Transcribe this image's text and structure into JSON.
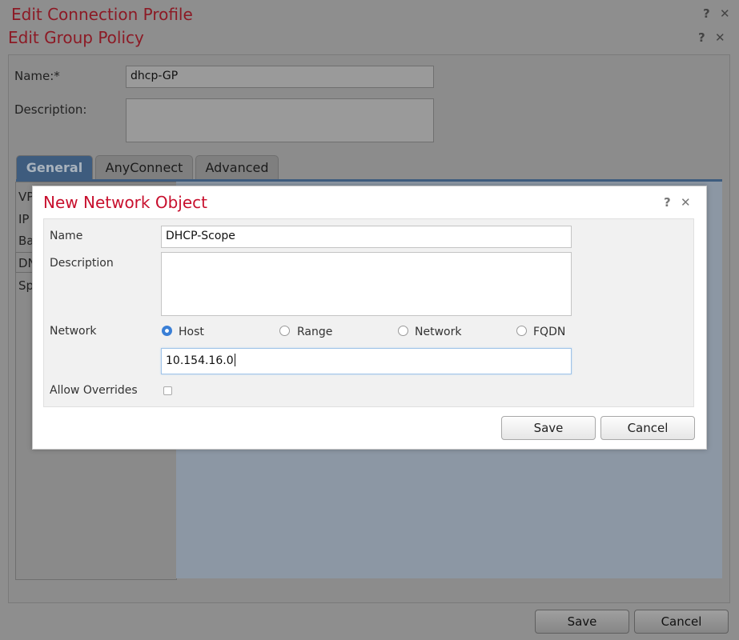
{
  "connection_profile": {
    "title": "Edit Connection Profile",
    "help_label": "?",
    "close_label": "✕",
    "save_label": "Save",
    "cancel_label": "Cancel"
  },
  "group_policy": {
    "title": "Edit Group Policy",
    "help_label": "?",
    "close_label": "✕",
    "name_label": "Name:*",
    "name_value": "dhcp-GP",
    "description_label": "Description:",
    "description_value": "",
    "tabs": [
      {
        "label": "General",
        "active": true
      },
      {
        "label": "AnyConnect",
        "active": false
      },
      {
        "label": "Advanced",
        "active": false
      }
    ],
    "sidebar_items": [
      "VP",
      "IP",
      "Ba",
      "DN",
      "Sp"
    ]
  },
  "network_object": {
    "title": "New Network Object",
    "help_label": "?",
    "close_label": "✕",
    "name_label": "Name",
    "name_value": "DHCP-Scope",
    "description_label": "Description",
    "description_value": "",
    "network_label": "Network",
    "network_options": [
      {
        "label": "Host",
        "selected": true
      },
      {
        "label": "Range",
        "selected": false
      },
      {
        "label": "Network",
        "selected": false
      },
      {
        "label": "FQDN",
        "selected": false
      }
    ],
    "network_value": "10.154.16.0",
    "allow_overrides_label": "Allow Overrides",
    "allow_overrides_checked": false,
    "save_label": "Save",
    "cancel_label": "Cancel"
  },
  "colors": {
    "title_red": "#c8102e",
    "radio_selected": "#3a7fd6",
    "tab_active": "#3e5c7e"
  }
}
